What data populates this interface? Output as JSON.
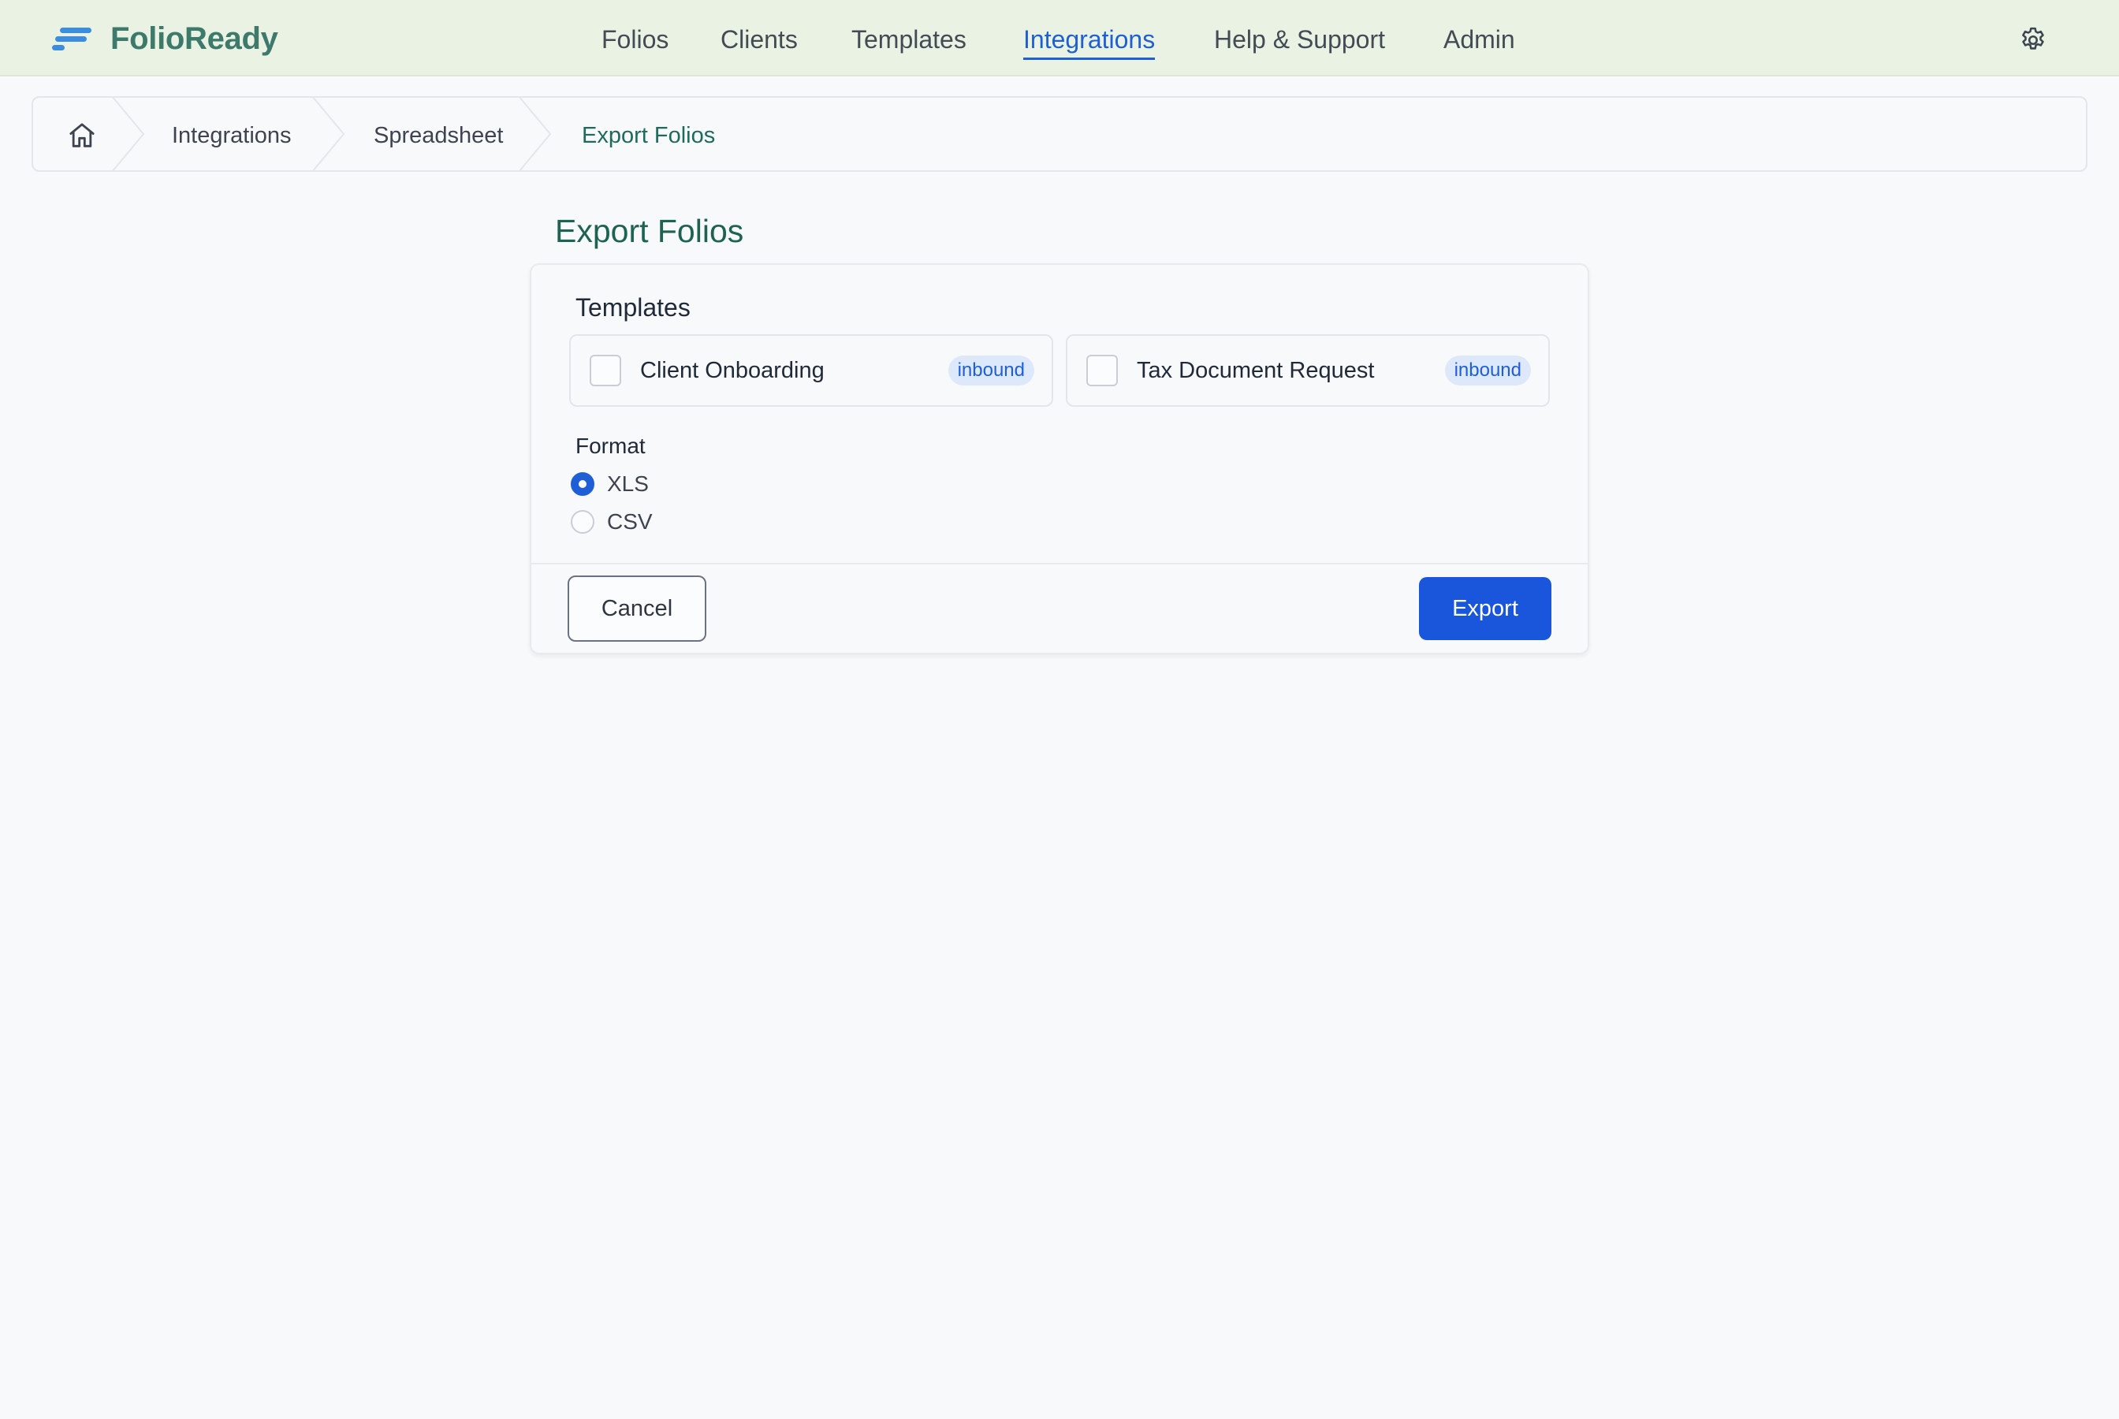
{
  "app": {
    "name": "FolioReady",
    "accent_color": "#1f5fd6",
    "brand_color": "#3d7a6c",
    "header_bg": "#eaf3e3"
  },
  "nav": {
    "items": [
      {
        "label": "Folios",
        "active": false
      },
      {
        "label": "Clients",
        "active": false
      },
      {
        "label": "Templates",
        "active": false
      },
      {
        "label": "Integrations",
        "active": true
      },
      {
        "label": "Help & Support",
        "active": false
      },
      {
        "label": "Admin",
        "active": false
      }
    ],
    "settings_icon": "gear-icon"
  },
  "breadcrumb": {
    "home_icon": "home-icon",
    "items": [
      "Integrations",
      "Spreadsheet",
      "Export Folios"
    ]
  },
  "page": {
    "title": "Export Folios"
  },
  "form": {
    "templates_label": "Templates",
    "templates": [
      {
        "name": "Client Onboarding",
        "badge": "inbound",
        "checked": false
      },
      {
        "name": "Tax Document Request",
        "badge": "inbound",
        "checked": false
      }
    ],
    "format_label": "Format",
    "formats": [
      {
        "label": "XLS",
        "selected": true
      },
      {
        "label": "CSV",
        "selected": false
      }
    ],
    "cancel_label": "Cancel",
    "export_label": "Export"
  }
}
